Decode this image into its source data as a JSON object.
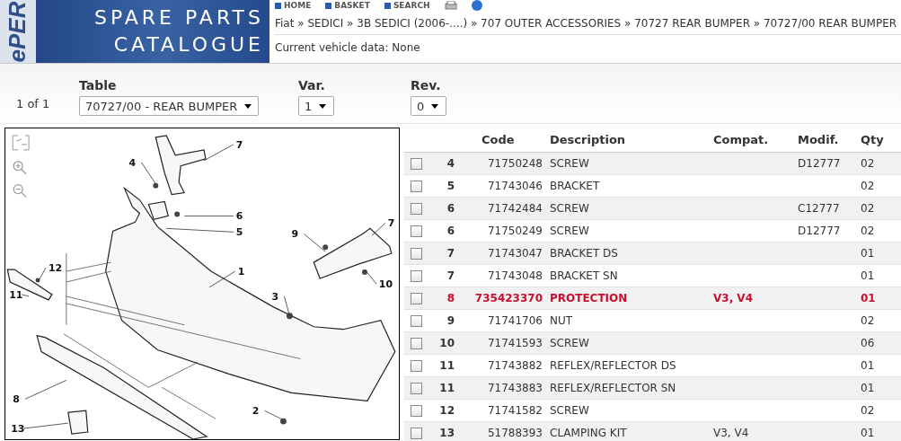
{
  "header": {
    "logo_side": "ePER",
    "logo_title": "SPARE PARTS",
    "logo_subtitle": "CATALOGUE",
    "nav": [
      {
        "label": "HOME"
      },
      {
        "label": "BASKET"
      },
      {
        "label": "SEARCH"
      }
    ],
    "breadcrumb": "Fiat » SEDICI » 3B SEDICI (2006-....) » 707 OUTER ACCESSORIES » 70727 REAR BUMPER » 70727/00 REAR BUMPER",
    "vehicle_data": "Current vehicle data: None"
  },
  "selector": {
    "page": "1 of 1",
    "fields": [
      {
        "label": "Table",
        "value": "70727/00 -  REAR BUMPER"
      },
      {
        "label": "Var.",
        "value": "1"
      },
      {
        "label": "Rev.",
        "value": "0"
      }
    ]
  },
  "diagram": {
    "callouts": [
      "7",
      "4",
      "6",
      "5",
      "9",
      "7",
      "12",
      "1",
      "11",
      "10",
      "3",
      "8",
      "2",
      "13"
    ]
  },
  "table": {
    "columns": [
      "Code",
      "Description",
      "Compat.",
      "Modif.",
      "Qty"
    ],
    "rows": [
      {
        "ref": "4",
        "code": "71750248",
        "description": "SCREW",
        "modif": "D12777",
        "qty": "02",
        "checked": false,
        "highlighted": false
      },
      {
        "ref": "5",
        "code": "71743046",
        "description": "BRACKET",
        "qty": "02",
        "checked": false,
        "highlighted": false
      },
      {
        "ref": "6",
        "code": "71742484",
        "description": "SCREW",
        "modif": "C12777",
        "qty": "02",
        "checked": false,
        "highlighted": false
      },
      {
        "ref": "6",
        "code": "71750249",
        "description": "SCREW",
        "modif": "D12777",
        "qty": "02",
        "checked": false,
        "highlighted": false
      },
      {
        "ref": "7",
        "code": "71743047",
        "description": "BRACKET DS",
        "qty": "01",
        "checked": false,
        "highlighted": false
      },
      {
        "ref": "7",
        "code": "71743048",
        "description": "BRACKET SN",
        "qty": "01",
        "checked": false,
        "highlighted": false
      },
      {
        "ref": "8",
        "code": "735423370",
        "description": "PROTECTION",
        "compat": "V3, V4",
        "qty": "01",
        "checked": false,
        "highlighted": true
      },
      {
        "ref": "9",
        "code": "71741706",
        "description": "NUT",
        "qty": "02",
        "checked": false,
        "highlighted": false
      },
      {
        "ref": "10",
        "code": "71741593",
        "description": "SCREW",
        "qty": "06",
        "checked": false,
        "highlighted": false
      },
      {
        "ref": "11",
        "code": "71743882",
        "description": "REFLEX/REFLECTOR DS",
        "qty": "01",
        "checked": false,
        "highlighted": false
      },
      {
        "ref": "11",
        "code": "71743883",
        "description": "REFLEX/REFLECTOR SN",
        "qty": "01",
        "checked": false,
        "highlighted": false
      },
      {
        "ref": "12",
        "code": "71741582",
        "description": "SCREW",
        "qty": "02",
        "checked": false,
        "highlighted": false
      },
      {
        "ref": "13",
        "code": "51788393",
        "description": "CLAMPING KIT",
        "compat": "V3, V4",
        "qty": "01",
        "checked": false,
        "highlighted": false
      }
    ]
  }
}
